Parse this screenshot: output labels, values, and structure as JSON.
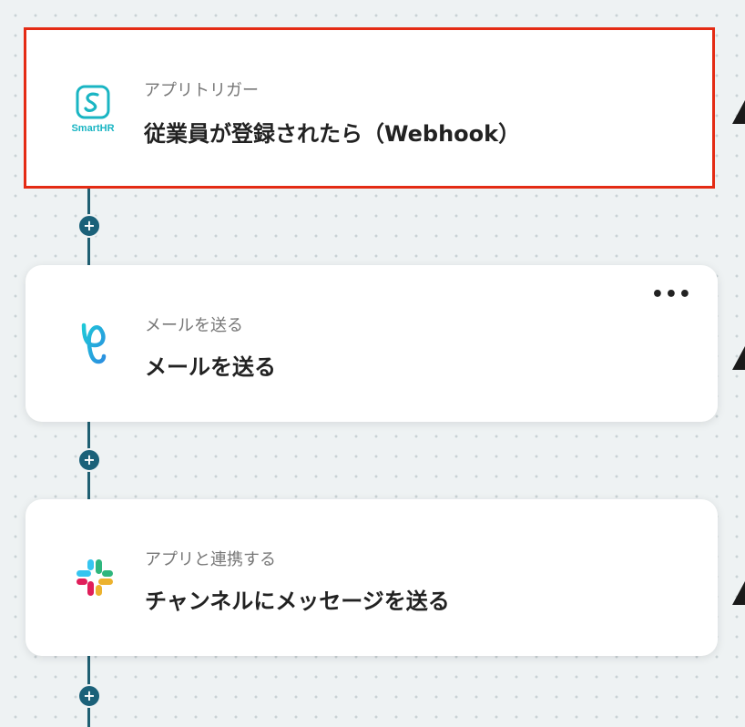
{
  "flow": {
    "trigger": {
      "app_label": "アプリトリガー",
      "title": "従業員が登録されたら（Webhook）",
      "logo_text": "SmartHR",
      "logo_color": "#1ab5c3"
    },
    "steps": [
      {
        "app_label": "メールを送る",
        "title": "メールを送る",
        "more_label": "•••",
        "icon": "yoom-mail-icon",
        "icon_colors": [
          "#1ec8d8",
          "#2b8fe0"
        ]
      },
      {
        "app_label": "アプリと連携する",
        "title": "チャンネルにメッセージを送る",
        "icon": "slack-icon",
        "icon_colors": [
          "#36c5f0",
          "#2eb67d",
          "#ecb22e",
          "#e01e5a"
        ]
      }
    ],
    "add_label": "+"
  }
}
